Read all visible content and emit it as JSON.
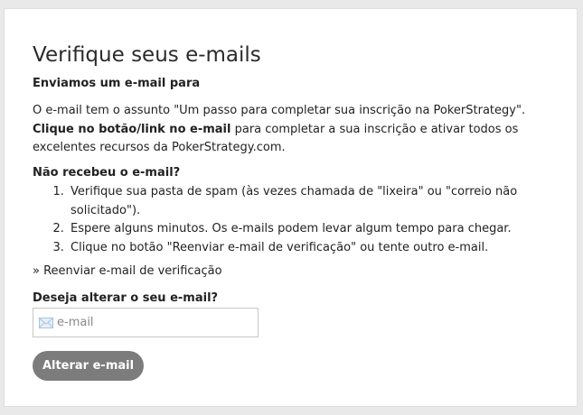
{
  "page": {
    "title": "Verifique seus e-mails",
    "subheading": "Enviamos um e-mail para",
    "intro_part1": "O e-mail tem o assunto \"Um passo para completar sua inscrição na PokerStrategy\". ",
    "intro_bold": "Clique no botão/link no e-mail",
    "intro_part2": " para completar a sua inscrição e ativar todos os excelentes recursos da PokerStrategy.com."
  },
  "not_received": {
    "heading": "Não recebeu o e-mail?",
    "steps": [
      "Verifique sua pasta de spam (às vezes chamada de \"lixeira\" ou \"correio não solicitado\").",
      "Espere alguns minutos. Os e-mails podem levar algum tempo para chegar.",
      "Clique no botão \"Reenviar e-mail de verificação\" ou tente outro e-mail."
    ]
  },
  "resend_link": "» Reenviar e-mail de verificação",
  "change_email": {
    "heading": "Deseja alterar o seu e-mail?",
    "input_placeholder": "e-mail",
    "input_value": "",
    "icon": "envelope-icon",
    "button_label": "Alterar e-mail"
  },
  "colors": {
    "button_bg": "#7c7c7c",
    "icon_color": "#a9c4dc",
    "page_bg": "#e9e9e9"
  }
}
